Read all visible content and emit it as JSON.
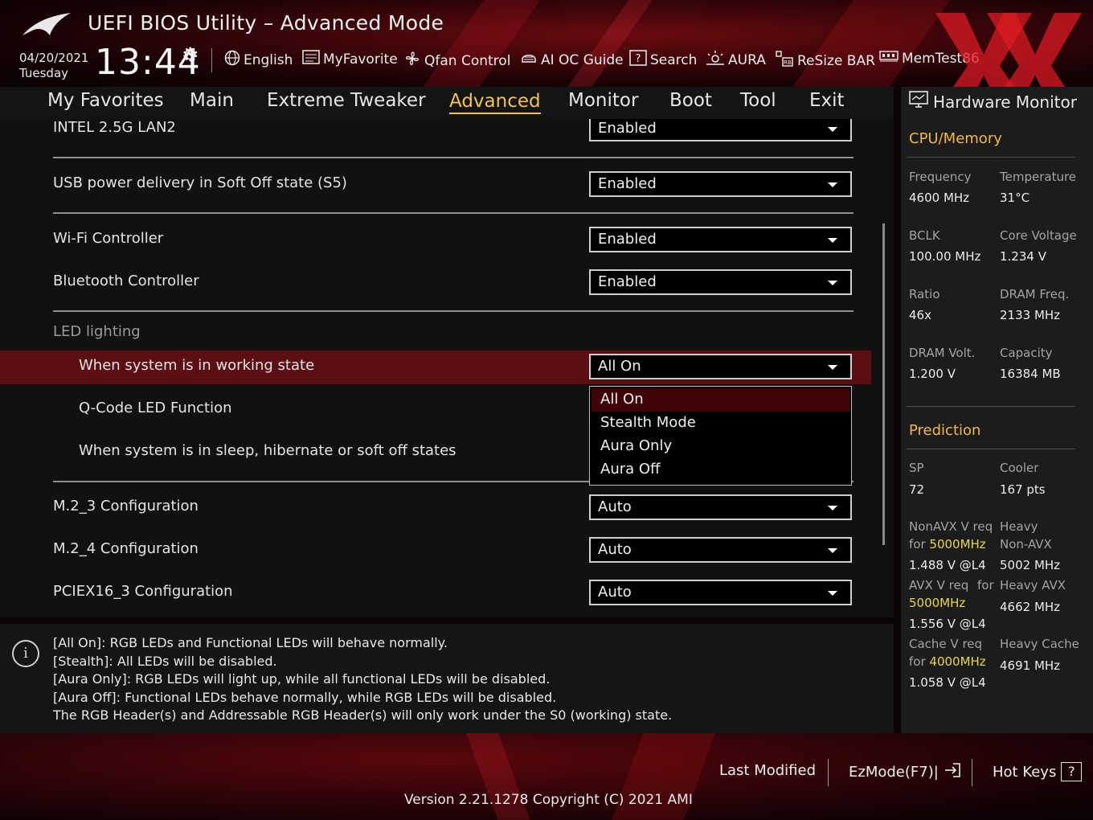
{
  "header": {
    "title": "UEFI BIOS Utility – Advanced Mode",
    "date": "04/20/2021",
    "weekday": "Tuesday",
    "time": "13:44",
    "toolbar": [
      {
        "label": "English",
        "icon": "globe-icon"
      },
      {
        "label": "MyFavorite",
        "icon": "favorite-icon"
      },
      {
        "label": "Qfan Control",
        "icon": "fan-icon"
      },
      {
        "label": "AI OC Guide",
        "icon": "ai-chip-icon"
      },
      {
        "label": "Search",
        "icon": "help-search-icon"
      },
      {
        "label": "AURA",
        "icon": "aura-light-icon"
      },
      {
        "label": "ReSize BAR",
        "icon": "resize-bar-icon"
      },
      {
        "label": "MemTest86",
        "icon": "memory-icon"
      }
    ]
  },
  "nav": {
    "tabs": [
      "My Favorites",
      "Main",
      "Extreme Tweaker",
      "Advanced",
      "Monitor",
      "Boot",
      "Tool",
      "Exit"
    ],
    "active": "Advanced"
  },
  "settings": {
    "intel_lan2": {
      "label": "INTEL 2.5G LAN2",
      "value": "Enabled"
    },
    "usb_power": {
      "label": "USB power delivery in Soft Off state (S5)",
      "value": "Enabled"
    },
    "wifi": {
      "label": "Wi-Fi Controller",
      "value": "Enabled"
    },
    "bluetooth": {
      "label": "Bluetooth Controller",
      "value": "Enabled"
    },
    "led_group": "LED lighting",
    "working_state": {
      "label": "When system is in working state",
      "value": "All On"
    },
    "qcode": {
      "label": "Q-Code LED Function"
    },
    "sleep_state": {
      "label": "When system is in sleep, hibernate or soft off states"
    },
    "m2_3": {
      "label": "M.2_3 Configuration",
      "value": "Auto"
    },
    "m2_4": {
      "label": "M.2_4 Configuration",
      "value": "Auto"
    },
    "pciex16_3": {
      "label": "PCIEX16_3 Configuration",
      "value": "Auto"
    }
  },
  "dropdown": {
    "options": [
      "All On",
      "Stealth Mode",
      "Aura Only",
      "Aura Off"
    ],
    "selected": "All On"
  },
  "help": {
    "lines": [
      "[All On]: RGB LEDs and Functional LEDs will behave normally.",
      "[Stealth]: All LEDs will be disabled.",
      "[Aura Only]: RGB LEDs will light up, while all functional LEDs will be disabled.",
      "[Aura Off]: Functional LEDs behave normally, while RGB LEDs will be disabled.",
      "The RGB Header(s) and Addressable RGB Header(s) will only work under the S0 (working) state."
    ]
  },
  "hardware_monitor": {
    "title": "Hardware Monitor",
    "cpu_memory": {
      "heading": "CPU/Memory",
      "frequency_label": "Frequency",
      "frequency": "4600 MHz",
      "temperature_label": "Temperature",
      "temperature": "31°C",
      "bclk_label": "BCLK",
      "bclk": "100.00 MHz",
      "core_voltage_label": "Core Voltage",
      "core_voltage": "1.234 V",
      "ratio_label": "Ratio",
      "ratio": "46x",
      "dram_freq_label": "DRAM Freq.",
      "dram_freq": "2133 MHz",
      "dram_volt_label": "DRAM Volt.",
      "dram_volt": "1.200 V",
      "capacity_label": "Capacity",
      "capacity": "16384 MB"
    },
    "prediction": {
      "heading": "Prediction",
      "sp_label": "SP",
      "sp": "72",
      "cooler_label": "Cooler",
      "cooler": "167 pts",
      "nonavx_req_label": "NonAVX V req",
      "nonavx_for": "for",
      "nonavx_freq": "5000MHz",
      "nonavx_volt": "1.488 V @L4",
      "heavy_nonavx_label_1": "Heavy",
      "heavy_nonavx_label_2": "Non-AVX",
      "heavy_nonavx": "5002 MHz",
      "avx_req_label": "AVX V req",
      "avx_for": "for",
      "avx_freq": "5000MHz",
      "avx_volt": "1.556 V @L4",
      "heavy_avx_label": "Heavy AVX",
      "heavy_avx": "4662 MHz",
      "cache_req_label": "Cache V req",
      "cache_for": "for",
      "cache_freq": "4000MHz",
      "cache_volt": "1.058 V @L4",
      "heavy_cache_label": "Heavy Cache",
      "heavy_cache": "4691 MHz"
    }
  },
  "footer": {
    "last_modified": "Last Modified",
    "ezmode": "EzMode(F7)|",
    "hot_keys": "Hot Keys",
    "hot_keys_key": "?",
    "version": "Version 2.21.1278 Copyright (C) 2021 AMI"
  },
  "colors": {
    "accent": "#f2c44a",
    "highlight_row": "#5c0f13",
    "monitor_heading": "#f0b84a",
    "frequency_highlight": "#e9d83a"
  }
}
